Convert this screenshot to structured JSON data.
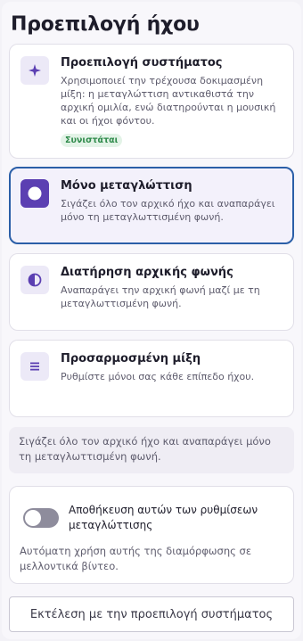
{
  "page": {
    "title": "Προεπιλογή ήχου"
  },
  "options": [
    {
      "title": "Προεπιλογή συστήματος",
      "description": "Χρησιμοποιεί την τρέχουσα δοκιμασμένη μίξη: η μεταγλώττιση αντικαθιστά την αρχική ομιλία, ενώ διατηρούνται η μουσική και οι ήχοι φόντου.",
      "badge": "Συνιστάται",
      "icon": "sparkle-icon",
      "selected": false
    },
    {
      "title": "Μόνο μεταγλώττιση",
      "description": "Σιγάζει όλο τον αρχικό ήχο και αναπαράγει μόνο τη μεταγλωττισμένη φωνή.",
      "icon": "record-dot-icon",
      "selected": true
    },
    {
      "title": "Διατήρηση αρχικής φωνής",
      "description": "Αναπαράγει την αρχική φωνή μαζί με τη μεταγλωττισμένη φωνή.",
      "icon": "half-circle-icon",
      "selected": false
    },
    {
      "title": "Προσαρμοσμένη μίξη",
      "description": "Ρυθμίστε μόνοι σας κάθε επίπεδο ήχου.",
      "icon": "sliders-icon",
      "selected": false
    }
  ],
  "info_text": "Σιγάζει όλο τον αρχικό ήχο και αναπαράγει μόνο τη μεταγλωττισμένη φωνή.",
  "save_settings": {
    "label": "Αποθήκευση αυτών των ρυθμίσεων μεταγλώττισης",
    "description": "Αυτόματη χρήση αυτής της διαμόρφωσης σε μελλοντικά βίντεο.",
    "enabled": false
  },
  "run_button": "Εκτέλεση με την προεπιλογή συστήματος",
  "colors": {
    "accent": "#5b3fb2",
    "selected_border": "#2b5fa8",
    "recommended": "#2e8a4a"
  }
}
